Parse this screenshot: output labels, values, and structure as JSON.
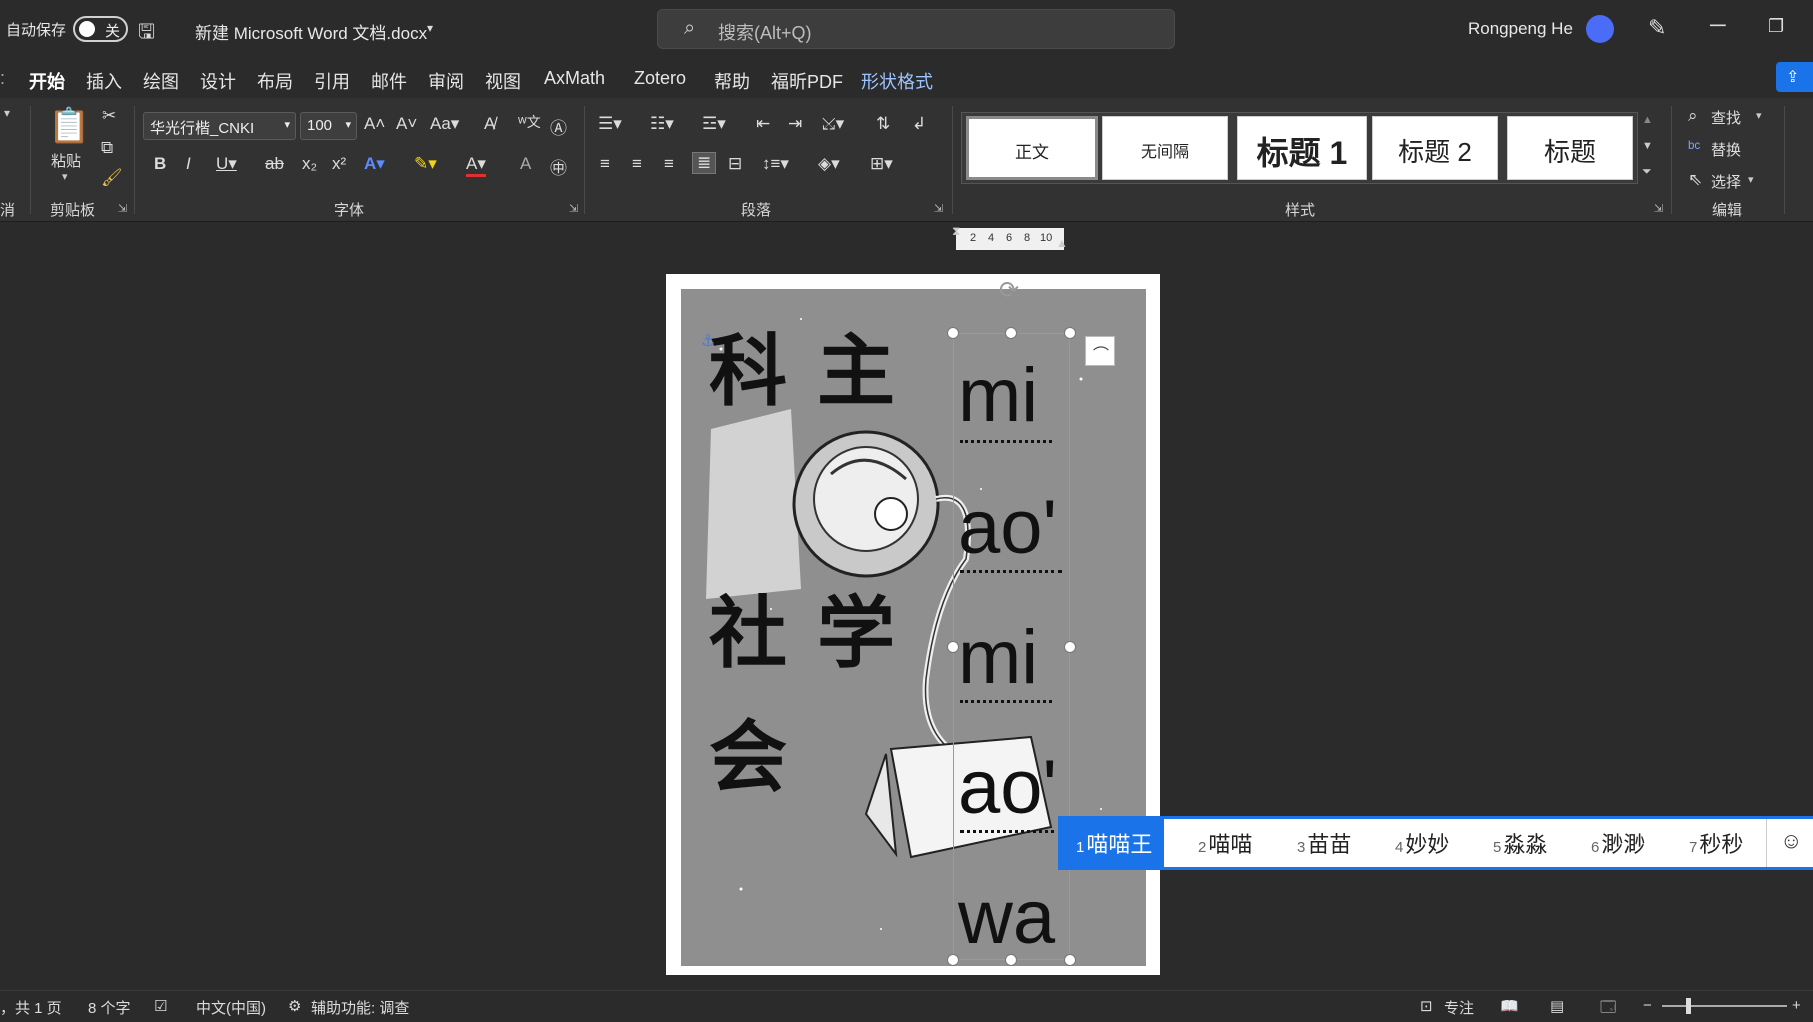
{
  "titlebar": {
    "autosave_label": "自动保存",
    "autosave_state": "关",
    "doc_title": "新建 Microsoft Word 文档.docx",
    "search_placeholder": "搜索(Alt+Q)",
    "user_name": "Rongpeng He"
  },
  "tabs": [
    "开始",
    "插入",
    "绘图",
    "设计",
    "布局",
    "引用",
    "邮件",
    "审阅",
    "视图",
    "AxMath",
    "Zotero",
    "帮助",
    "福昕PDF",
    "形状格式"
  ],
  "ribbon": {
    "clipboard": {
      "paste": "粘贴",
      "group": "剪贴板",
      "left_cut": "消"
    },
    "font": {
      "name": "华光行楷_CNKI",
      "size": "100",
      "group": "字体"
    },
    "paragraph": {
      "group": "段落"
    },
    "styles": {
      "items": [
        "正文",
        "无间隔",
        "标题 1",
        "标题 2",
        "标题"
      ],
      "group": "样式"
    },
    "editing": {
      "find": "查找",
      "replace": "替换",
      "select": "选择",
      "group": "编辑"
    }
  },
  "ruler": {
    "ticks": [
      "2",
      "4",
      "6",
      "8",
      "10"
    ]
  },
  "document": {
    "chars": [
      "科",
      "主",
      "社",
      "学",
      "会"
    ],
    "pinyin": [
      "mi",
      "ao'",
      "mi",
      "ao'",
      "wa"
    ]
  },
  "ime": {
    "candidates": [
      {
        "num": "1",
        "text": "喵喵王"
      },
      {
        "num": "2",
        "text": "喵喵"
      },
      {
        "num": "3",
        "text": "苗苗"
      },
      {
        "num": "4",
        "text": "妙妙"
      },
      {
        "num": "5",
        "text": "淼淼"
      },
      {
        "num": "6",
        "text": "渺渺"
      },
      {
        "num": "7",
        "text": "秒秒"
      }
    ]
  },
  "status": {
    "page": "，共 1 页",
    "words": "8 个字",
    "language": "中文(中国)",
    "accessibility": "辅助功能: 调查",
    "focus": "专注"
  }
}
